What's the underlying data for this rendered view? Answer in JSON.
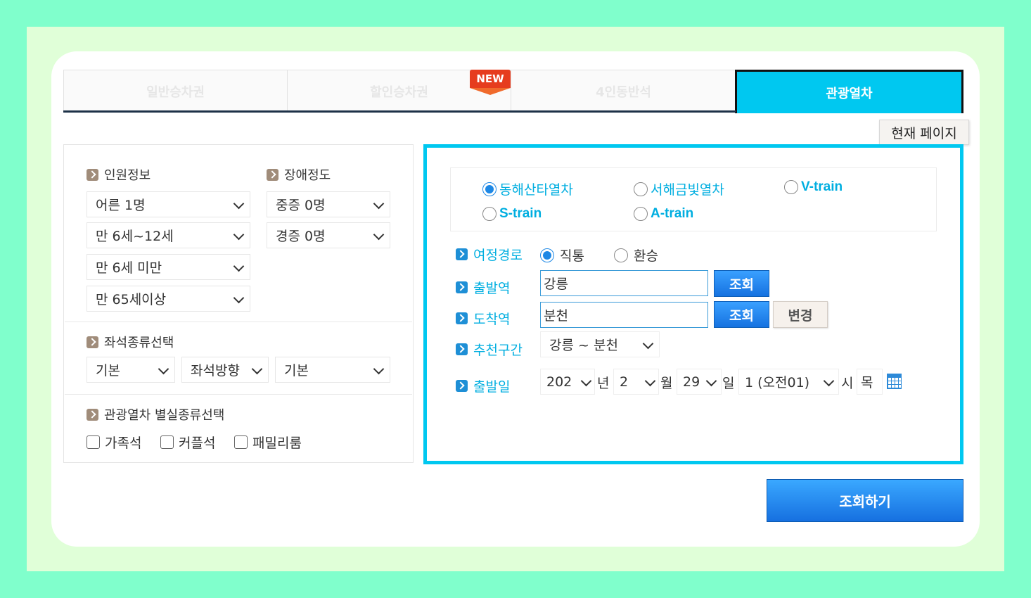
{
  "tabs": [
    {
      "label": "일반승차권",
      "active": false
    },
    {
      "label": "할인승차권",
      "active": false
    },
    {
      "label": "4인동반석",
      "active": false
    },
    {
      "label": "관광열차",
      "active": true
    }
  ],
  "new_badge": "NEW",
  "tooltip": "현재 페이지",
  "passengers": {
    "title": "인원정보",
    "selects": [
      "어른 1명",
      "만 6세~12세",
      "만 6세 미만",
      "만 65세이상"
    ]
  },
  "disability": {
    "title": "장애정도",
    "selects": [
      "중증 0명",
      "경증 0명"
    ]
  },
  "seat_type": {
    "title": "좌석종류선택",
    "selects": [
      "기본",
      "좌석방향",
      "기본"
    ]
  },
  "room_type": {
    "title": "관광열차 별실종류선택",
    "options": [
      "가족석",
      "커플석",
      "패밀리룸"
    ]
  },
  "trains": [
    {
      "label": "동해산타열차",
      "selected": true
    },
    {
      "label": "서해금빛열차",
      "selected": false
    },
    {
      "label": "V-train",
      "selected": false
    },
    {
      "label": "S-train",
      "selected": false
    },
    {
      "label": "A-train",
      "selected": false
    }
  ],
  "route": {
    "label": "여정경로",
    "options": [
      {
        "label": "직통",
        "selected": true
      },
      {
        "label": "환승",
        "selected": false
      }
    ]
  },
  "departure": {
    "label": "출발역",
    "value": "강릉",
    "button": "조회"
  },
  "arrival": {
    "label": "도착역",
    "value": "분천",
    "button": "조회",
    "change_button": "변경"
  },
  "recommend": {
    "label": "추천구간",
    "value": "강릉 ~ 분천"
  },
  "date": {
    "label": "출발일",
    "year": "202",
    "year_unit": "년",
    "month": "2",
    "month_unit": "월",
    "day": "29",
    "day_unit": "일",
    "hour": "1 (오전01)",
    "hour_unit": "시",
    "weekday": "목"
  },
  "search_button": "조회하기",
  "colors": {
    "accent": "#00c8f0",
    "button": "#1e88e5"
  }
}
